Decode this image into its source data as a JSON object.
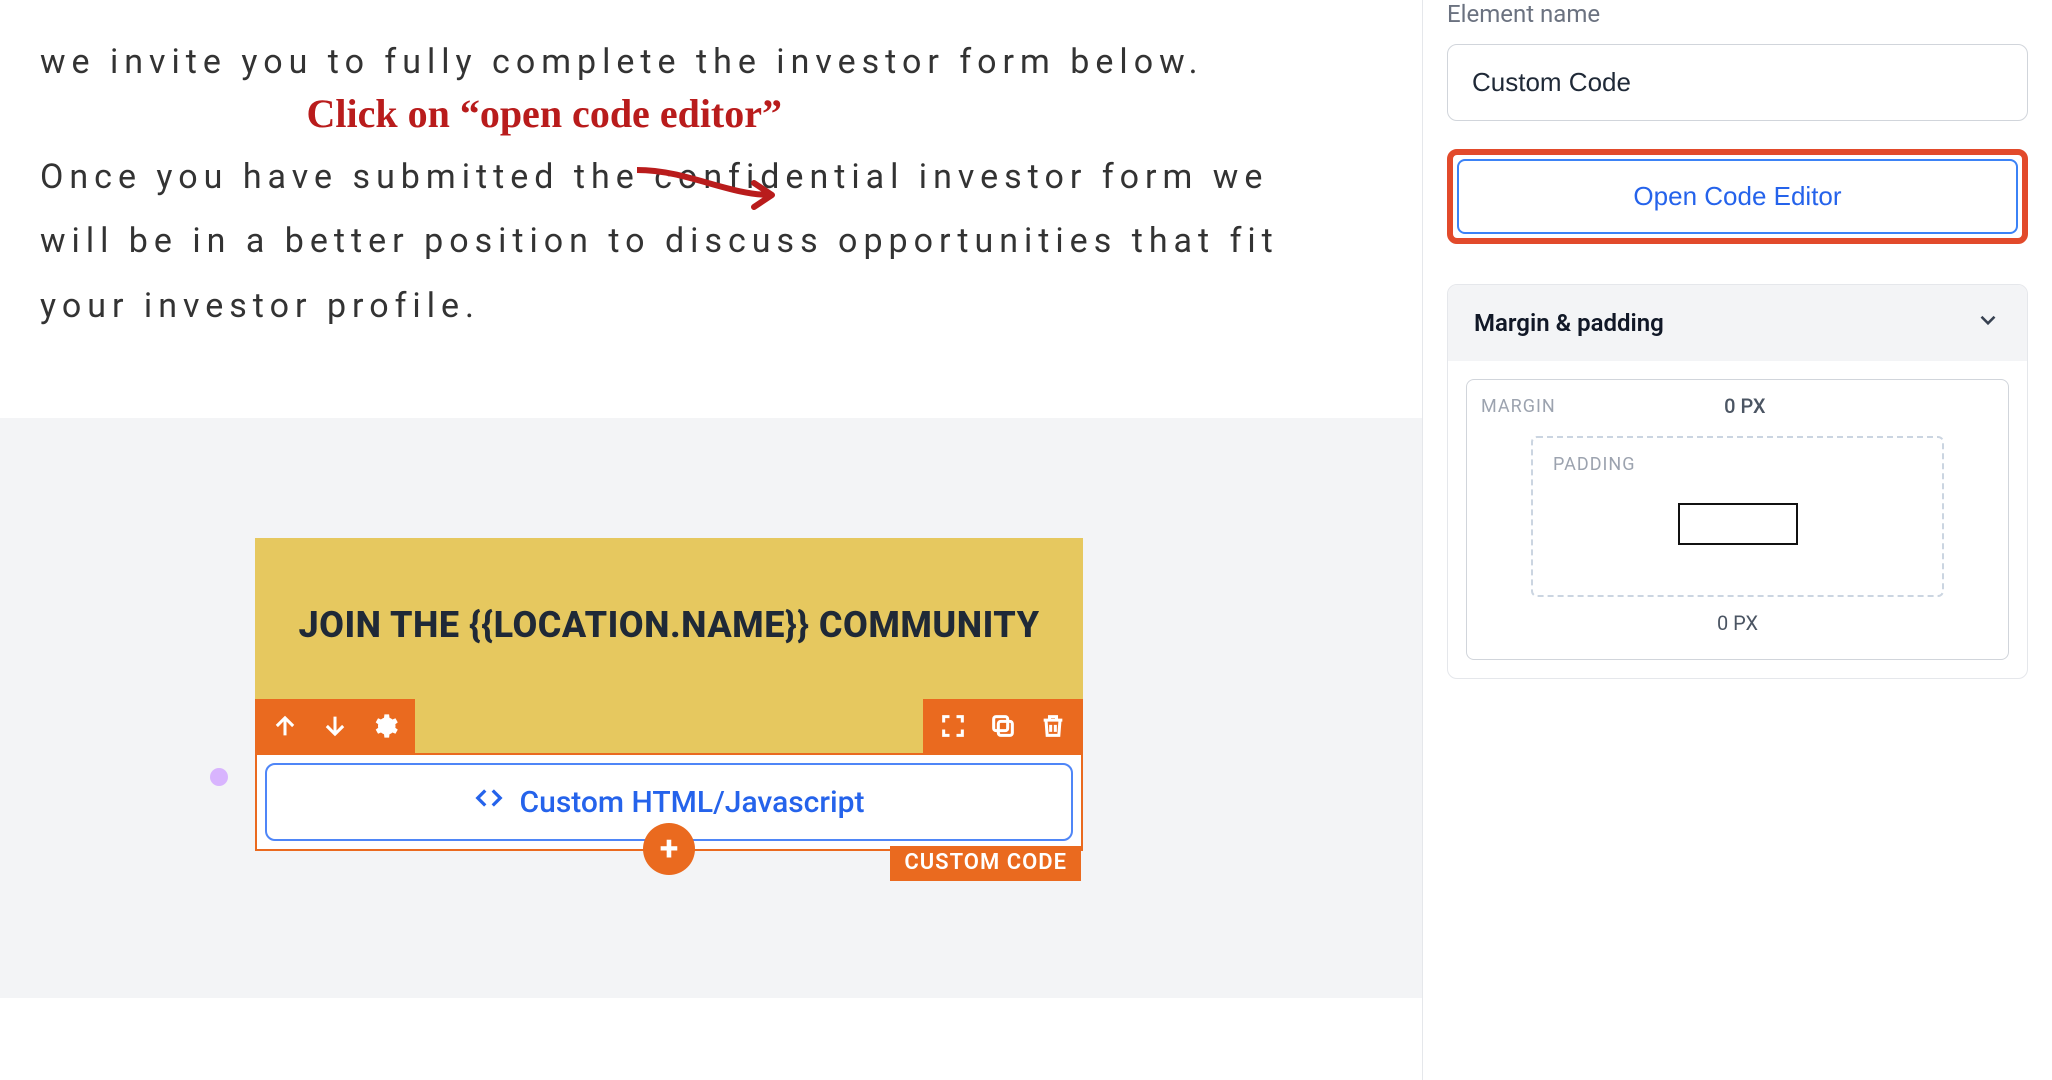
{
  "canvas": {
    "paragraph1": "we invite you to fully complete the investor form below.",
    "paragraph2": "Once you have submitted the confidential investor form we will be in a better position to discuss opportunities that fit your investor profile.",
    "yellow_heading": "JOIN THE {{LOCATION.NAME}} COMMUNITY",
    "custom_block_label": "Custom HTML/Javascript",
    "custom_code_tag": "CUSTOM CODE"
  },
  "annotation": {
    "text": "Click on “open code editor”"
  },
  "sidebar": {
    "element_name_label": "Element name",
    "element_name_value": "Custom Code",
    "open_editor_label": "Open Code Editor",
    "accordion": {
      "title": "Margin & padding",
      "margin_label": "MARGIN",
      "padding_label": "PADDING",
      "top_value": "0 PX",
      "bottom_value": "0 PX"
    }
  }
}
